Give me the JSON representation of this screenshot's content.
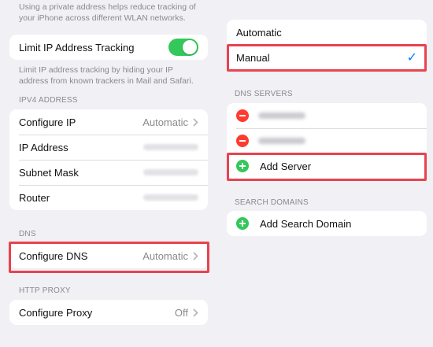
{
  "left": {
    "private_address_note": "Using a private address helps reduce tracking of your iPhone across different WLAN networks.",
    "limit_ip": {
      "label": "Limit IP Address Tracking",
      "enabled": true,
      "footnote": "Limit IP address tracking by hiding your IP address from known trackers in Mail and Safari."
    },
    "ipv4": {
      "header": "IPV4 ADDRESS",
      "configure_ip_label": "Configure IP",
      "configure_ip_value": "Automatic",
      "ip_address_label": "IP Address",
      "subnet_mask_label": "Subnet Mask",
      "router_label": "Router"
    },
    "dns": {
      "header": "DNS",
      "configure_dns_label": "Configure DNS",
      "configure_dns_value": "Automatic"
    },
    "http_proxy": {
      "header": "HTTP PROXY",
      "configure_proxy_label": "Configure Proxy",
      "configure_proxy_value": "Off"
    }
  },
  "right": {
    "mode_options": {
      "automatic_label": "Automatic",
      "manual_label": "Manual",
      "selected": "Manual"
    },
    "dns_servers": {
      "header": "DNS SERVERS",
      "add_server_label": "Add Server"
    },
    "search_domains": {
      "header": "SEARCH DOMAINS",
      "add_search_domain_label": "Add Search Domain"
    }
  },
  "colors": {
    "background": "#f0f0f5",
    "toggle_on": "#34c759",
    "delete_red": "#ff3b30",
    "add_green": "#34c759",
    "checkmark_blue": "#007aff",
    "annotation_red": "#e8434e"
  },
  "icons": [
    "chevron-right-icon",
    "checkmark-icon",
    "minus-circle-icon",
    "plus-circle-icon"
  ]
}
